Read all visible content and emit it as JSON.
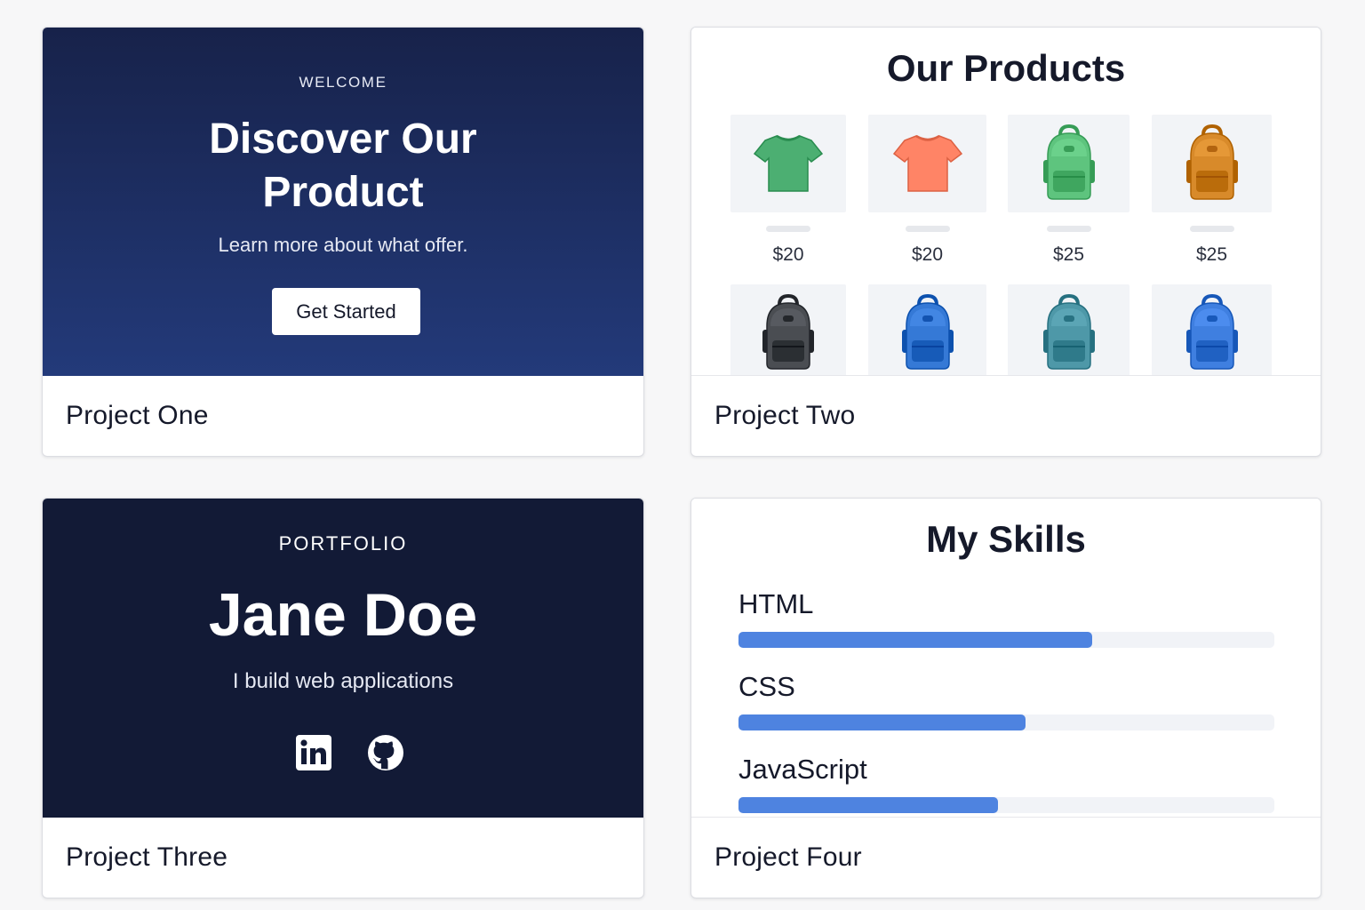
{
  "cards": [
    {
      "title": "Project One",
      "preview": {
        "eyebrow": "WELCOME",
        "headline_line1": "Discover Our",
        "headline_line2": "Product",
        "subtitle": "Learn more about what offer.",
        "cta_label": "Get Started"
      }
    },
    {
      "title": "Project Two",
      "preview": {
        "heading": "Our Products",
        "products": [
          {
            "icon": "tshirt-icon",
            "color": "#4caf72",
            "price": "$20"
          },
          {
            "icon": "tshirt-icon",
            "color": "#ff8466",
            "price": "$20"
          },
          {
            "icon": "backpack-icon",
            "color": "#5ec47e",
            "price": "$25"
          },
          {
            "icon": "backpack-icon",
            "color": "#d88a2a",
            "price": "$25"
          },
          {
            "icon": "backpack-icon",
            "color": "#4a4d52"
          },
          {
            "icon": "backpack-icon",
            "color": "#3579d6"
          },
          {
            "icon": "backpack-icon",
            "color": "#4e98a8"
          },
          {
            "icon": "backpack-icon",
            "color": "#3f7fe0"
          }
        ]
      }
    },
    {
      "title": "Project Three",
      "preview": {
        "eyebrow": "PORTFOLIO",
        "name": "Jane Doe",
        "subtitle": "I build web applications",
        "social": [
          "linkedin-icon",
          "github-icon"
        ]
      }
    },
    {
      "title": "Project Four",
      "preview": {
        "heading": "My Skills",
        "skills": [
          {
            "name": "HTML",
            "level": 0.66
          },
          {
            "name": "CSS",
            "level": 0.535
          },
          {
            "name": "JavaScript",
            "level": 0.485
          }
        ]
      }
    }
  ],
  "colors": {
    "hero_top": "#17224a",
    "hero_bottom": "#233a7a",
    "portfolio_bg": "#121a36",
    "skill_bar": "#4e83e0",
    "skill_track": "#f1f3f7"
  }
}
